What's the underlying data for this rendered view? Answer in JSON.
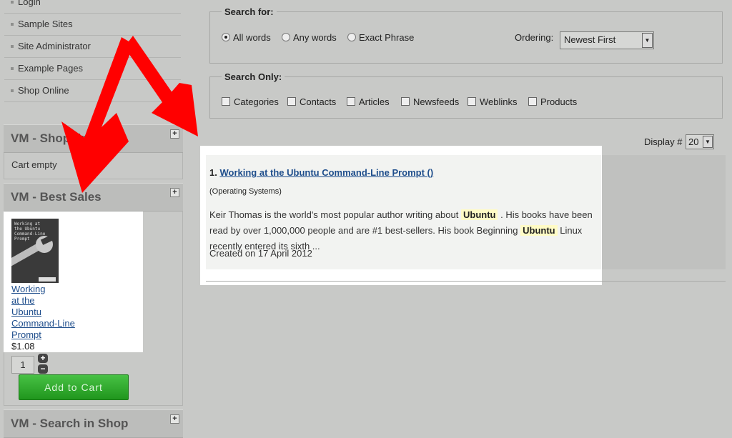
{
  "menu": {
    "items": [
      {
        "label": "Login"
      },
      {
        "label": "Sample Sites"
      },
      {
        "label": "Site Administrator"
      },
      {
        "label": "Example Pages"
      },
      {
        "label": "Shop Online"
      }
    ]
  },
  "modules": {
    "cart": {
      "title": "VM - Shopping Cart",
      "empty_text": "Cart empty"
    },
    "best_sales": {
      "title": "VM - Best Sales",
      "product": {
        "cover_text": [
          "Working at",
          "the Ubuntu",
          "Command-Line",
          "Prompt"
        ],
        "link_lines": [
          "Working",
          "at the",
          "Ubuntu",
          "Command-Line",
          "Prompt"
        ],
        "price": "$1.08",
        "quantity": "1",
        "add_to_cart": "Add to Cart"
      }
    },
    "search_shop": {
      "title": "VM - Search in Shop"
    },
    "toggle_glyph": "+"
  },
  "search": {
    "search_for_legend": "Search for:",
    "phrase_options": [
      {
        "label": "All words",
        "checked": true
      },
      {
        "label": "Any words",
        "checked": false
      },
      {
        "label": "Exact Phrase",
        "checked": false
      }
    ],
    "ordering_label": "Ordering:",
    "ordering_value": "Newest First",
    "search_only_legend": "Search Only:",
    "areas": [
      "Categories",
      "Contacts",
      "Articles",
      "Newsfeeds",
      "Weblinks",
      "Products"
    ],
    "display_label": "Display #",
    "display_value": "20"
  },
  "results": [
    {
      "number": "1.",
      "title": "Working at the Ubuntu Command-Line Prompt ()",
      "category": "(Operating Systems)",
      "text_1": "Keir Thomas is the world's most popular author writing about",
      "highlight": "Ubuntu",
      "text_2": ". His books have been read by over 1,000,000",
      "text_3": "people and are #1 best-sellers. His book Beginning",
      "text_4": "Linux recently entered its sixth ...",
      "date": "Created on 17 April 2012"
    }
  ],
  "colors": {
    "page_bg": "#c8c9c7",
    "link": "#1f4e8c",
    "highlight_bg": "#fffbc5",
    "arrow": "#ff0000",
    "add_to_cart_green": "#2fae2c"
  }
}
